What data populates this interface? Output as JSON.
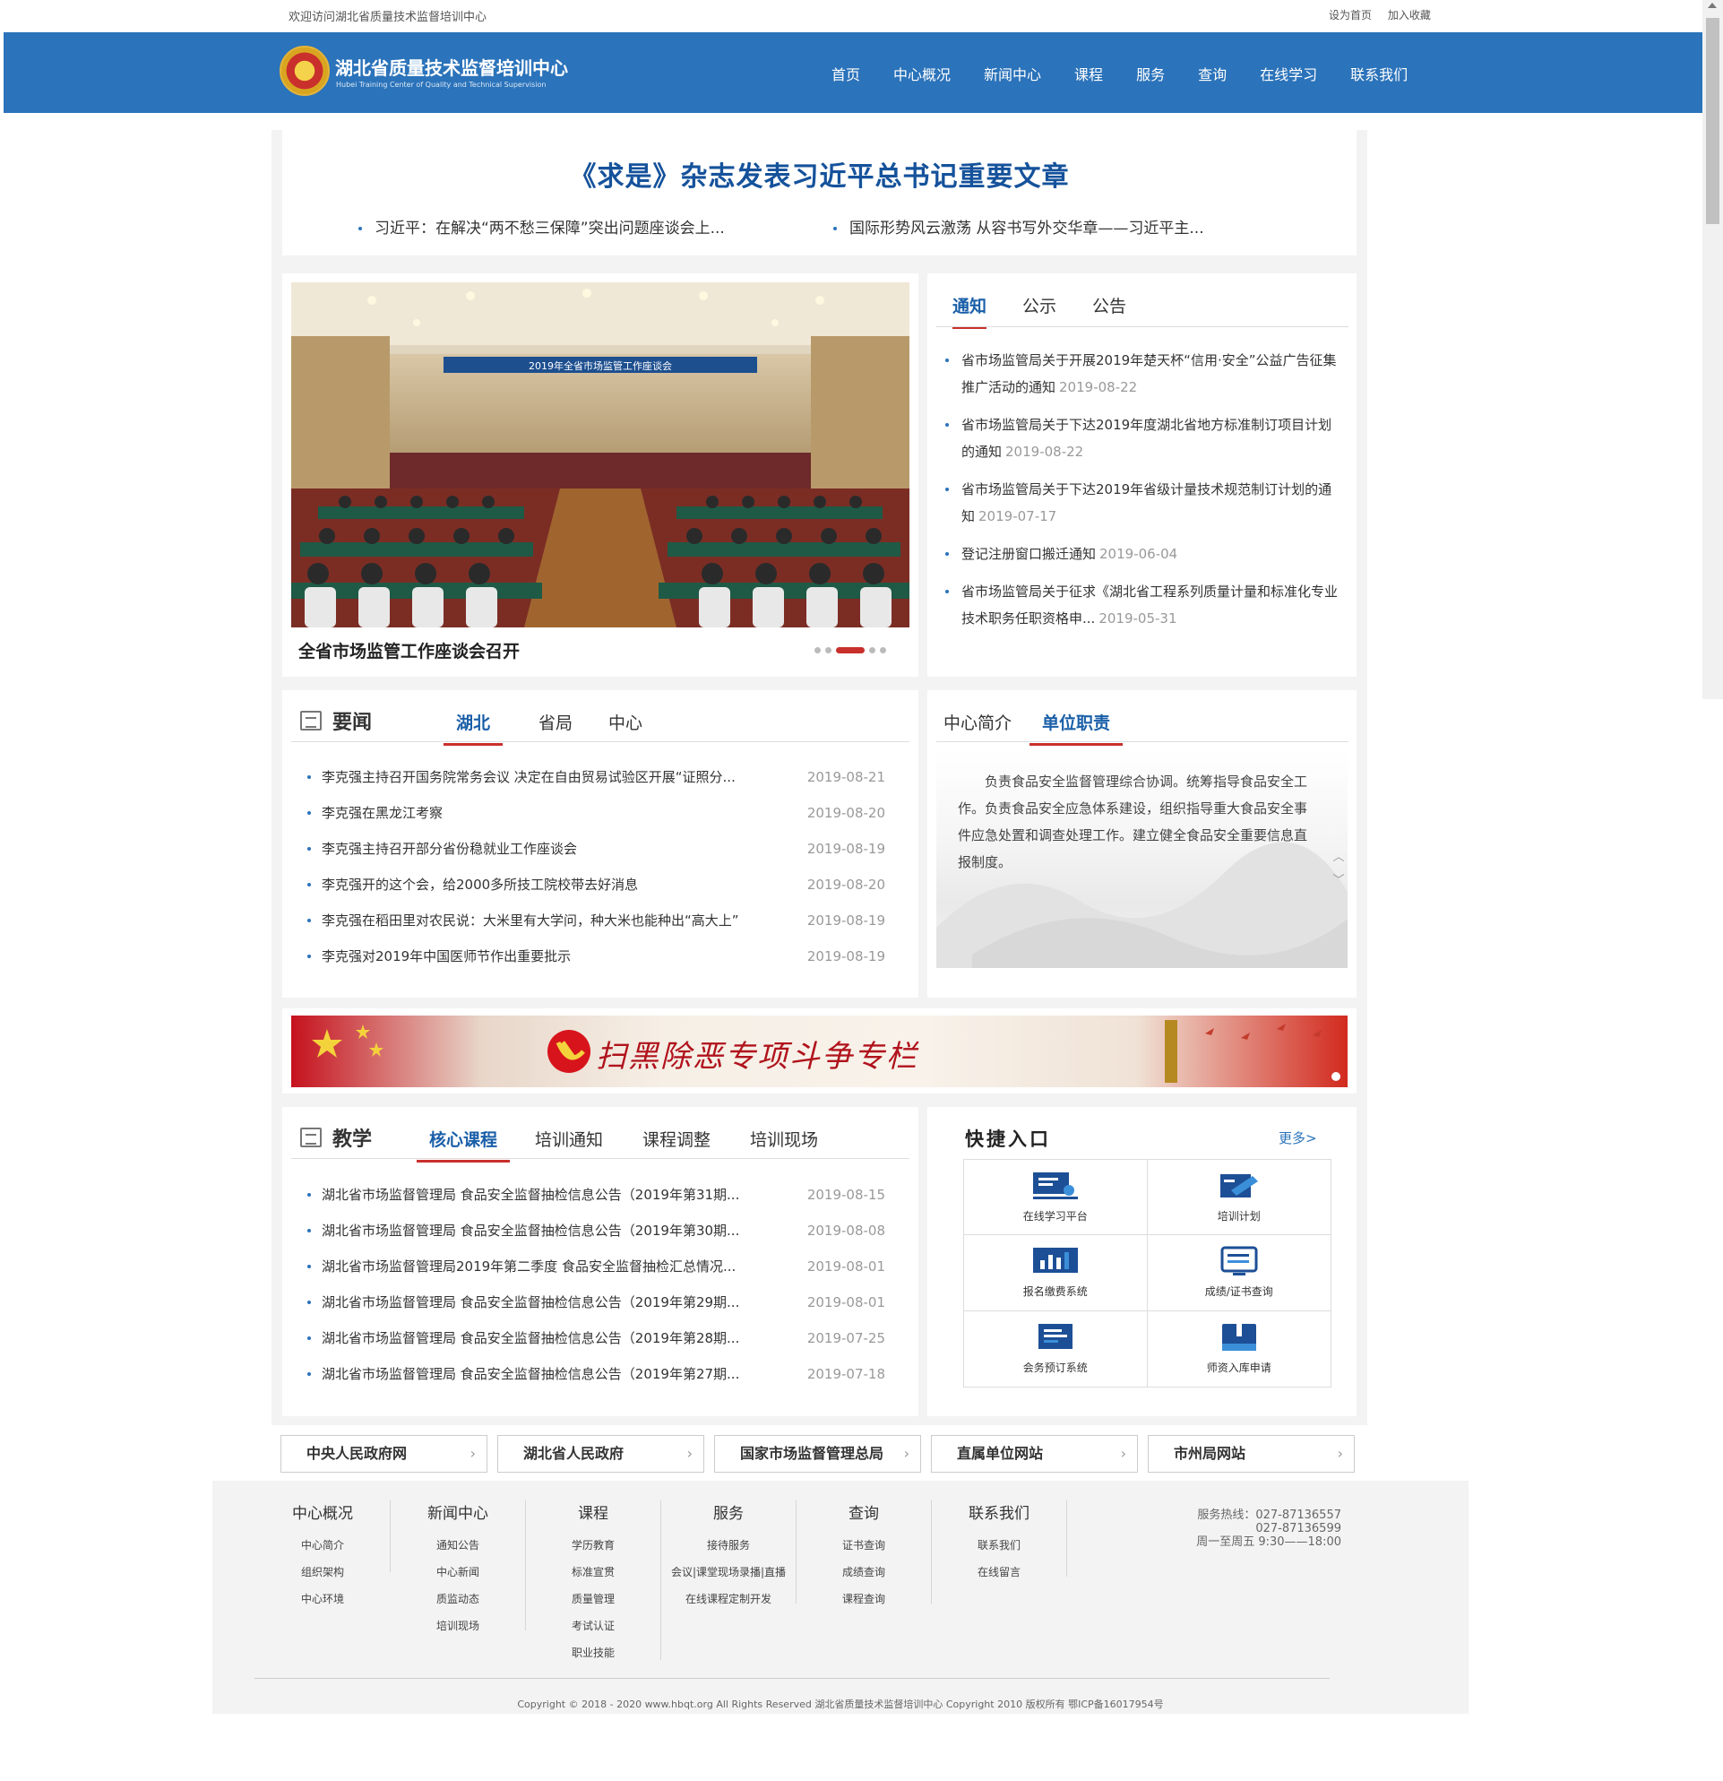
{
  "topbar": {
    "welcome": "欢迎访问湖北省质量技术监督培训中心",
    "set_home": "设为首页",
    "bookmark": "加入收藏"
  },
  "header": {
    "brand_cn": "湖北省质量技术监督培训中心",
    "brand_en": "Hubei Training Center of Quality and Technical Supervision",
    "nav": [
      "首页",
      "中心概况",
      "新闻中心",
      "课程",
      "服务",
      "查询",
      "在线学习",
      "联系我们"
    ]
  },
  "headline": {
    "title": "《求是》杂志发表习近平总书记重要文章",
    "subs": [
      "习近平：在解决“两不愁三保障”突出问题座谈会上...",
      "国际形势风云激荡 从容书写外交华章——习近平主..."
    ]
  },
  "slider": {
    "caption": "全省市场监管工作座谈会召开",
    "photo_banner": "2019年全省市场监管工作座谈会",
    "slides": 5,
    "active_slide": 3
  },
  "notices": {
    "tabs": [
      "通知",
      "公示",
      "公告"
    ],
    "items": [
      {
        "text": "省市场监管局关于开展2019年楚天杯“信用·安全”公益广告征集推广活动的通知",
        "date": "2019-08-22"
      },
      {
        "text": "省市场监管局关于下达2019年度湖北省地方标准制订项目计划的通知",
        "date": "2019-08-22"
      },
      {
        "text": "省市场监管局关于下达2019年省级计量技术规范制订计划的通知",
        "date": "2019-07-17"
      },
      {
        "text": "登记注册窗口搬迁通知",
        "date": "2019-06-04"
      },
      {
        "text": "省市场监管局关于征求《湖北省工程系列质量计量和标准化专业技术职务任职资格申...",
        "date": "2019-05-31"
      }
    ]
  },
  "news": {
    "title": "要闻",
    "tabs": [
      "湖北",
      "省局",
      "中心"
    ],
    "items": [
      {
        "text": "李克强主持召开国务院常务会议 决定在自由贸易试验区开展“证照分...",
        "date": "2019-08-21"
      },
      {
        "text": "李克强在黑龙江考察",
        "date": "2019-08-20"
      },
      {
        "text": "李克强主持召开部分省份稳就业工作座谈会",
        "date": "2019-08-19"
      },
      {
        "text": "李克强开的这个会，给2000多所技工院校带去好消息",
        "date": "2019-08-20"
      },
      {
        "text": "李克强在稻田里对农民说：大米里有大学问，种大米也能种出“高大上”",
        "date": "2019-08-19"
      },
      {
        "text": "李克强对2019年中国医师节作出重要批示",
        "date": "2019-08-19"
      }
    ]
  },
  "intro": {
    "tabs": [
      "中心简介",
      "单位职责"
    ],
    "text": "负责食品安全监督管理综合协调。统筹指导食品安全工作。负责食品安全应急体系建设，组织指导重大食品安全事件应急处置和调查处理工作。建立健全食品安全重要信息直报制度。"
  },
  "banner": {
    "text": "扫黑除恶专项斗争专栏"
  },
  "teaching": {
    "title": "教学",
    "tabs": [
      "核心课程",
      "培训通知",
      "课程调整",
      "培训现场"
    ],
    "items": [
      {
        "text": "湖北省市场监督管理局 食品安全监督抽检信息公告（2019年第31期...",
        "date": "2019-08-15"
      },
      {
        "text": "湖北省市场监督管理局 食品安全监督抽检信息公告（2019年第30期...",
        "date": "2019-08-08"
      },
      {
        "text": "湖北省市场监督管理局2019年第二季度 食品安全监督抽检汇总情况...",
        "date": "2019-08-01"
      },
      {
        "text": "湖北省市场监督管理局 食品安全监督抽检信息公告（2019年第29期...",
        "date": "2019-08-01"
      },
      {
        "text": "湖北省市场监督管理局 食品安全监督抽检信息公告（2019年第28期...",
        "date": "2019-07-25"
      },
      {
        "text": "湖北省市场监督管理局 食品安全监督抽检信息公告（2019年第27期...",
        "date": "2019-07-18"
      }
    ]
  },
  "quick": {
    "title": "快捷入口",
    "more": "更多>",
    "items": [
      {
        "label": "在线学习平台",
        "icon": "monitor-user-icon"
      },
      {
        "label": "培训计划",
        "icon": "folder-pen-icon"
      },
      {
        "label": "报名缴费系统",
        "icon": "bar-chart-icon"
      },
      {
        "label": "成绩/证书查询",
        "icon": "screen-list-icon"
      },
      {
        "label": "会务预订系统",
        "icon": "document-icon"
      },
      {
        "label": "师资入库申请",
        "icon": "book-icon"
      }
    ]
  },
  "links": [
    "中央人民政府网",
    "湖北省人民政府",
    "国家市场监督管理总局",
    "直属单位网站",
    "市州局网站"
  ],
  "footer": {
    "cols": [
      {
        "title": "中心概况",
        "items": [
          "中心简介",
          "组织架构",
          "中心环境"
        ]
      },
      {
        "title": "新闻中心",
        "items": [
          "通知公告",
          "中心新闻",
          "质监动态",
          "培训现场"
        ]
      },
      {
        "title": "课程",
        "items": [
          "学历教育",
          "标准宣贯",
          "质量管理",
          "考试认证",
          "职业技能"
        ]
      },
      {
        "title": "服务",
        "items": [
          "接待服务",
          "会议|课堂现场录播|直播",
          "在线课程定制开发"
        ]
      },
      {
        "title": "查询",
        "items": [
          "证书查询",
          "成绩查询",
          "课程查询"
        ]
      },
      {
        "title": "联系我们",
        "items": [
          "联系我们",
          "在线留言"
        ]
      }
    ],
    "hotline_label": "服务热线：027-87136557",
    "hotline2": "027-87136599",
    "hours": "周一至周五 9:30——18:00",
    "copyright": "Copyright © 2018 - 2020 www.hbqt.org All Rights Reserved 湖北省质量技术监督培训中心 Copyright 2010 版权所有 鄂ICP备16017954号"
  },
  "colors": {
    "brand_blue": "#2b73ba",
    "title_blue": "#15529b",
    "accent_red": "#c9302c"
  }
}
